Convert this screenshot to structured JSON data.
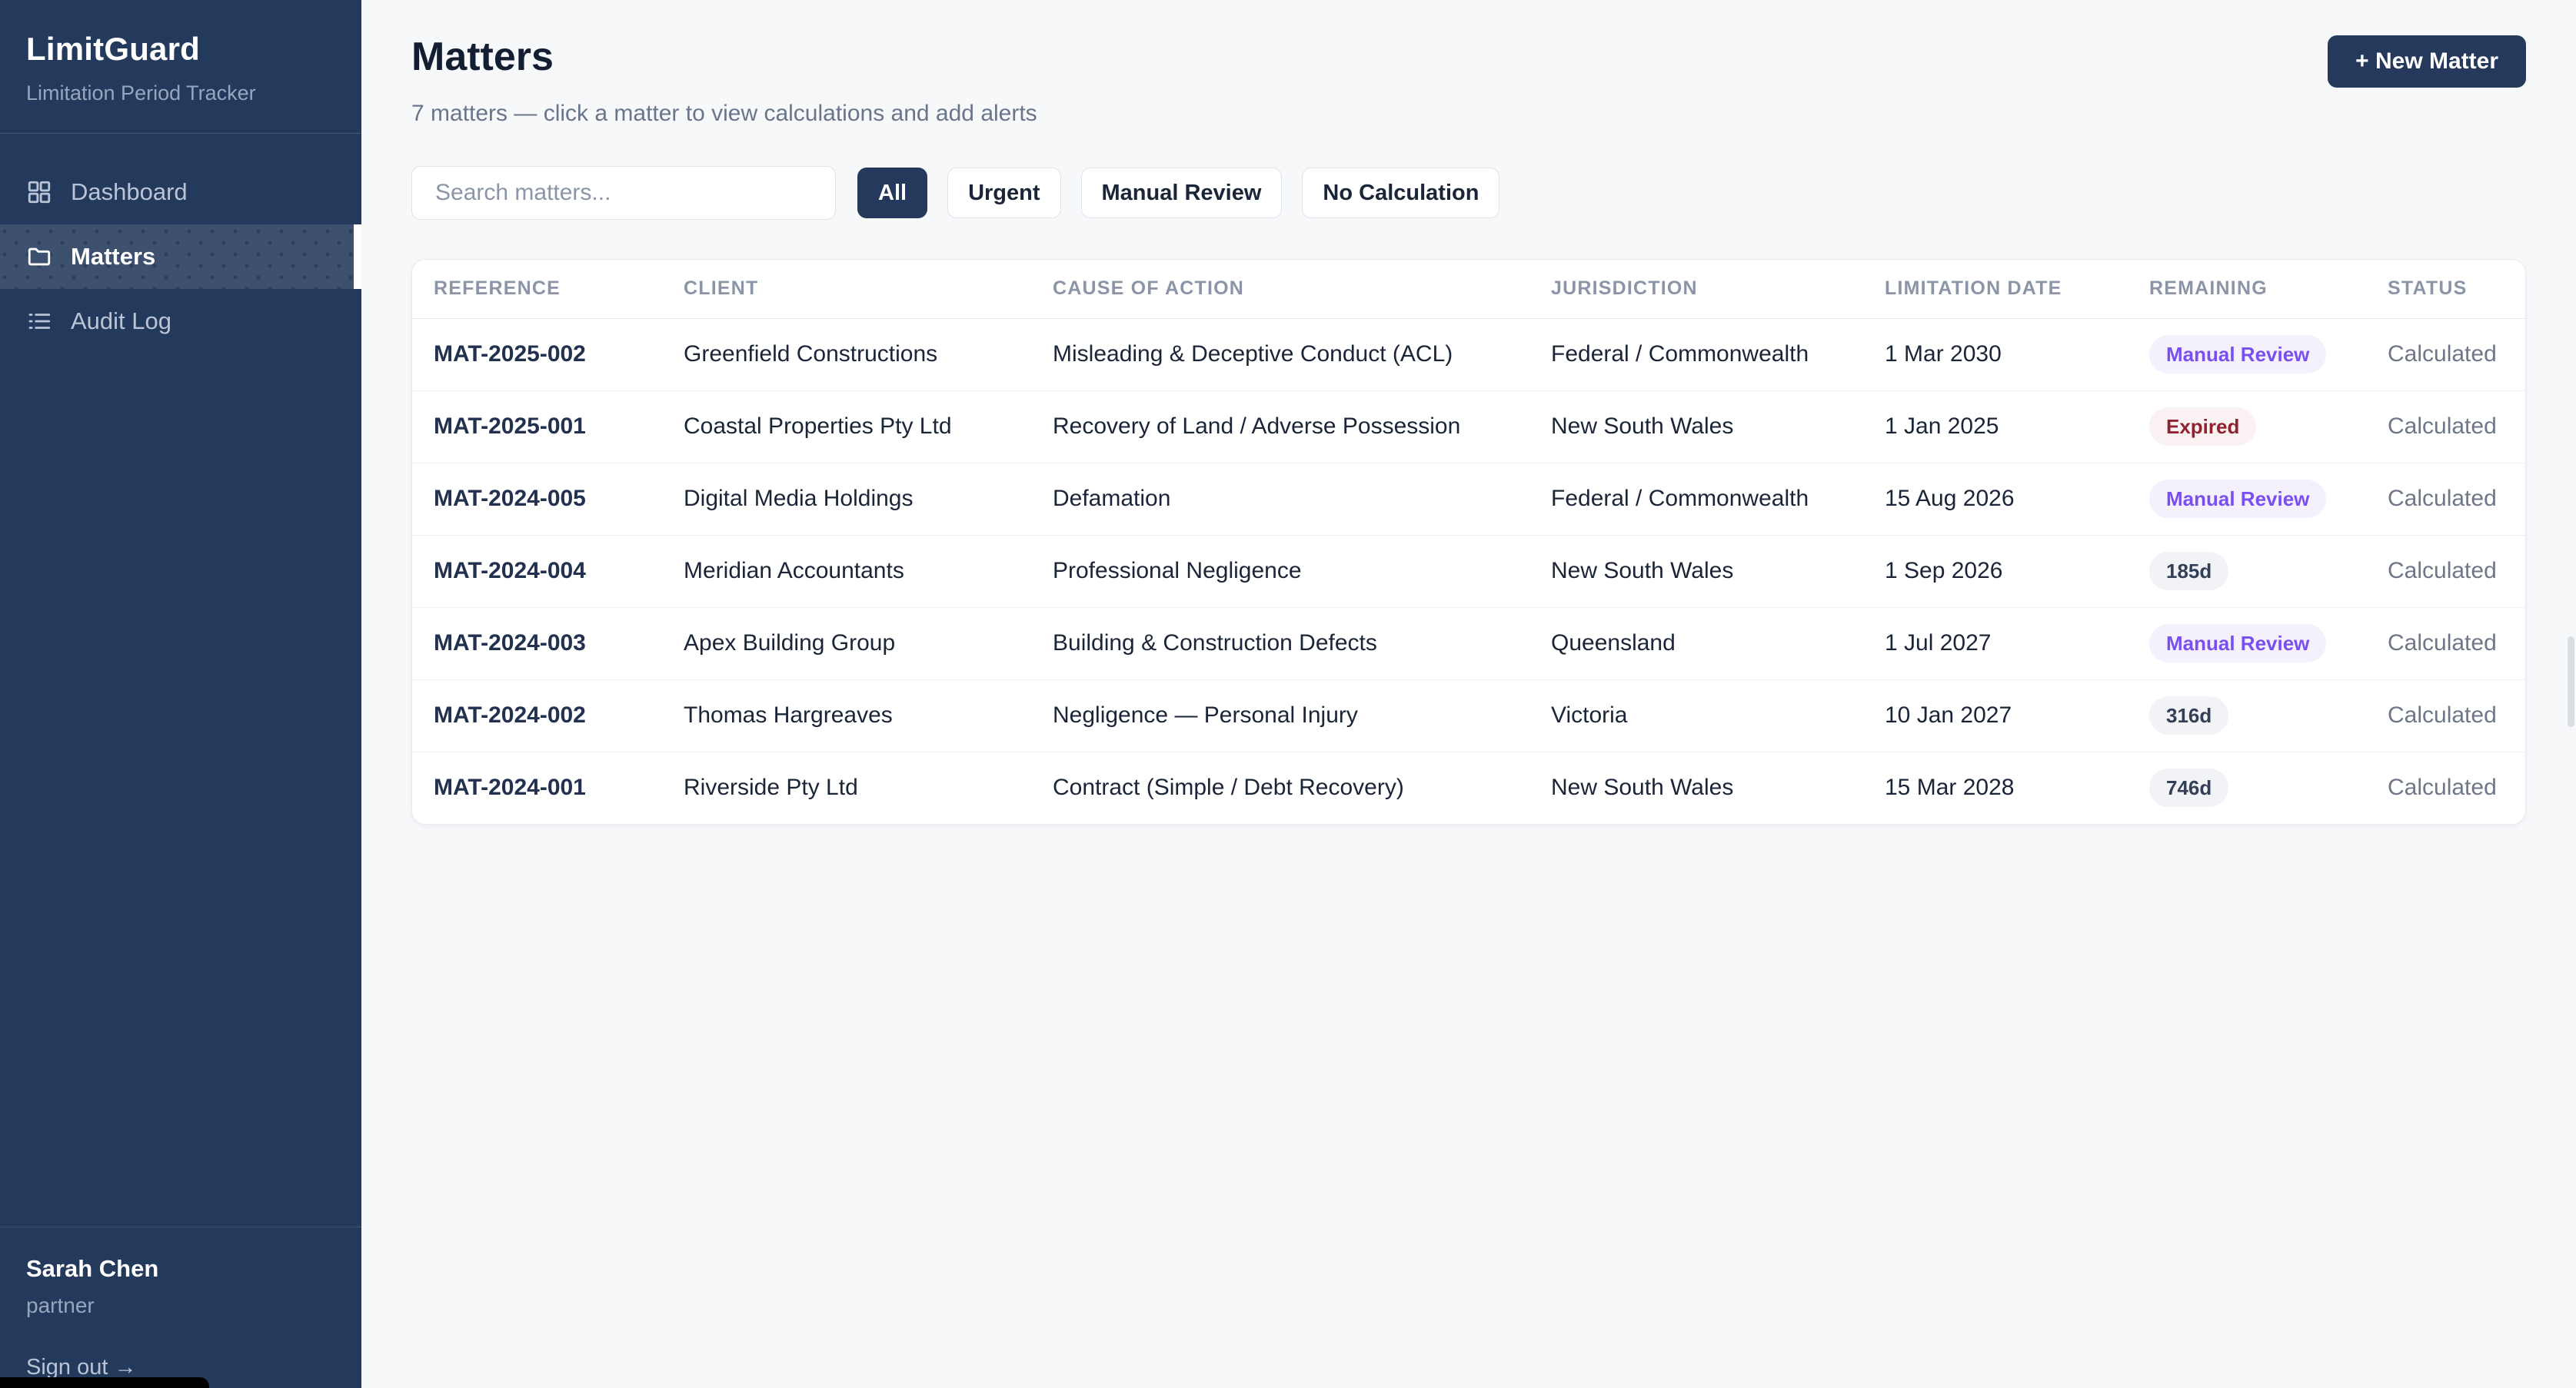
{
  "sidebar": {
    "logo": "LimitGuard",
    "tagline": "Limitation Period Tracker",
    "nav": [
      {
        "label": "Dashboard",
        "icon": "grid-icon",
        "active": false
      },
      {
        "label": "Matters",
        "icon": "folder-icon",
        "active": true
      },
      {
        "label": "Audit Log",
        "icon": "list-icon",
        "active": false
      }
    ],
    "user": {
      "name": "Sarah Chen",
      "role": "partner",
      "signout_label": "Sign out →"
    }
  },
  "header": {
    "title": "Matters",
    "subtitle": "7 matters — click a matter to view calculations and add alerts",
    "new_matter_label": "+ New Matter"
  },
  "toolbar": {
    "search_placeholder": "Search matters...",
    "filters": [
      {
        "label": "All",
        "active": true
      },
      {
        "label": "Urgent",
        "active": false
      },
      {
        "label": "Manual Review",
        "active": false
      },
      {
        "label": "No Calculation",
        "active": false
      }
    ]
  },
  "table": {
    "columns": [
      "REFERENCE",
      "CLIENT",
      "CAUSE OF ACTION",
      "JURISDICTION",
      "LIMITATION DATE",
      "REMAINING",
      "STATUS"
    ],
    "rows": [
      {
        "reference": "MAT-2025-002",
        "client": "Greenfield Constructions",
        "cause": "Misleading & Deceptive Conduct (ACL)",
        "jurisdiction": "Federal / Commonwealth",
        "limitation_date": "1 Mar 2030",
        "remaining": "Manual Review",
        "remaining_type": "review",
        "status": "Calculated"
      },
      {
        "reference": "MAT-2025-001",
        "client": "Coastal Properties Pty Ltd",
        "cause": "Recovery of Land / Adverse Possession",
        "jurisdiction": "New South Wales",
        "limitation_date": "1 Jan 2025",
        "remaining": "Expired",
        "remaining_type": "expired",
        "status": "Calculated"
      },
      {
        "reference": "MAT-2024-005",
        "client": "Digital Media Holdings",
        "cause": "Defamation",
        "jurisdiction": "Federal / Commonwealth",
        "limitation_date": "15 Aug 2026",
        "remaining": "Manual Review",
        "remaining_type": "review",
        "status": "Calculated"
      },
      {
        "reference": "MAT-2024-004",
        "client": "Meridian Accountants",
        "cause": "Professional Negligence",
        "jurisdiction": "New South Wales",
        "limitation_date": "1 Sep 2026",
        "remaining": "185d",
        "remaining_type": "days",
        "status": "Calculated"
      },
      {
        "reference": "MAT-2024-003",
        "client": "Apex Building Group",
        "cause": "Building & Construction Defects",
        "jurisdiction": "Queensland",
        "limitation_date": "1 Jul 2027",
        "remaining": "Manual Review",
        "remaining_type": "review",
        "status": "Calculated"
      },
      {
        "reference": "MAT-2024-002",
        "client": "Thomas Hargreaves",
        "cause": "Negligence — Personal Injury",
        "jurisdiction": "Victoria",
        "limitation_date": "10 Jan 2027",
        "remaining": "316d",
        "remaining_type": "days",
        "status": "Calculated"
      },
      {
        "reference": "MAT-2024-001",
        "client": "Riverside Pty Ltd",
        "cause": "Contract (Simple / Debt Recovery)",
        "jurisdiction": "New South Wales",
        "limitation_date": "15 Mar 2028",
        "remaining": "746d",
        "remaining_type": "days",
        "status": "Calculated"
      }
    ]
  },
  "colors": {
    "sidebar_bg": "#243a5c",
    "sidebar_active_bg": "#3d516f",
    "accent_navy": "#24395c",
    "page_bg": "#f7f8fa",
    "badge_review_text": "#7a4ff0",
    "badge_review_bg": "#f4f1fd",
    "badge_expired_text": "#8e222e",
    "badge_expired_bg": "#f9f1f2",
    "badge_days_text": "#333f56",
    "badge_days_bg": "#f2f3f7"
  }
}
